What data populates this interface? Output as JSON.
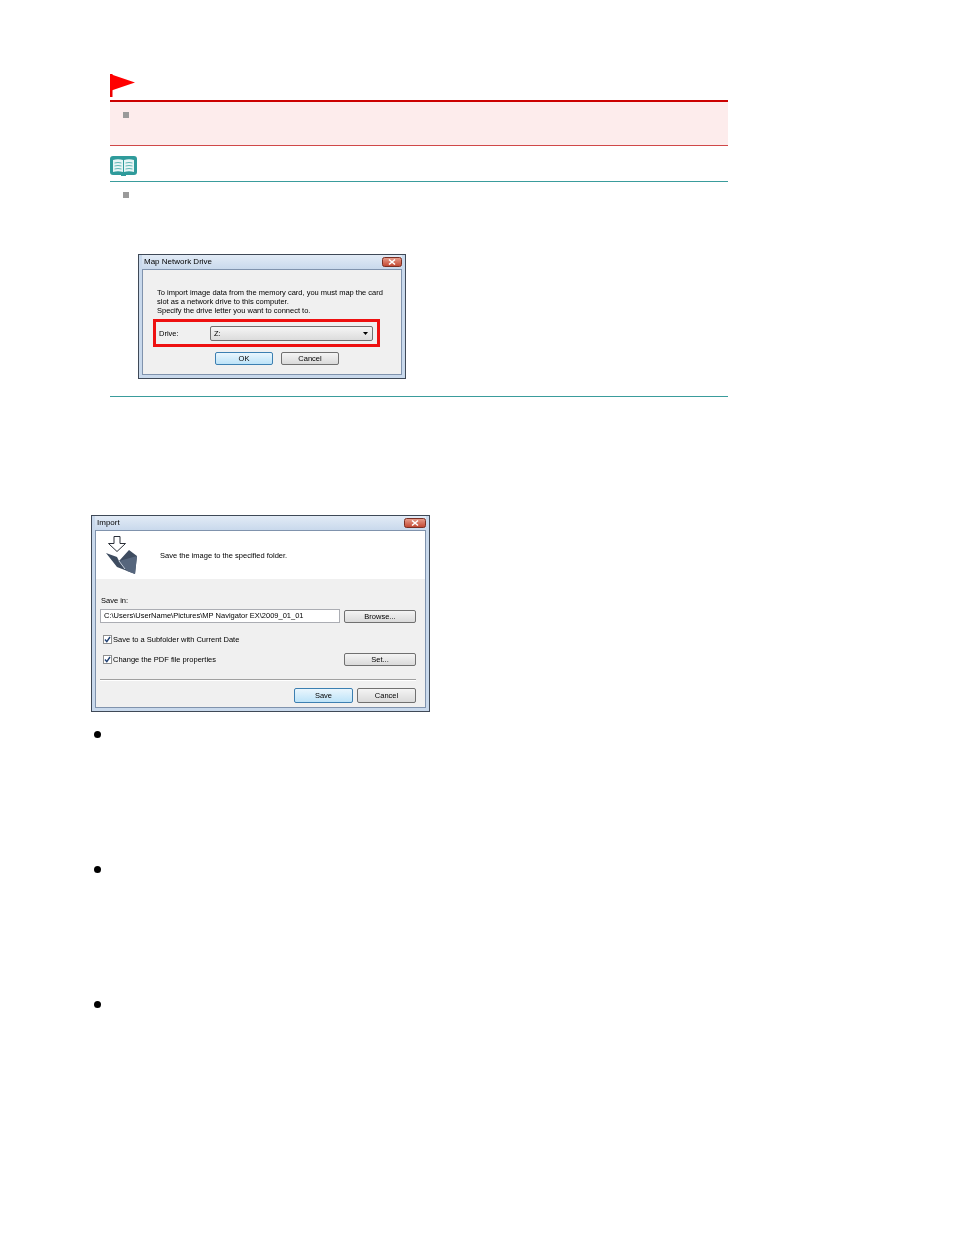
{
  "important_box": {
    "bullets": [
      {
        "kind": "square"
      }
    ]
  },
  "note_box": {
    "bullets": [
      {
        "kind": "square"
      }
    ],
    "dialog": {
      "title": "Map Network Drive",
      "message": [
        "To import image data from the memory card, you must map the card slot as a network drive to this computer.",
        "Specify the drive letter you want to connect to."
      ],
      "drive_label": "Drive:",
      "drive_value": "Z:",
      "highlighted": true,
      "buttons": [
        {
          "label": "OK",
          "default": true
        },
        {
          "label": "Cancel",
          "default": false
        }
      ]
    }
  },
  "import_dialog": {
    "title": "Import",
    "header": "Save the image to the specified folder.",
    "save_in_label": "Save in:",
    "save_in_value": "C:\\Users\\UserName\\Pictures\\MP Navigator EX\\2009_01_01",
    "browse_button": "Browse...",
    "options": [
      {
        "label": "Save to a Subfolder with Current Date",
        "checked": true
      },
      {
        "label": "Change the PDF file properties",
        "checked": true,
        "button": "Set..."
      }
    ],
    "buttons": [
      {
        "label": "Save",
        "default": true
      },
      {
        "label": "Cancel",
        "default": false
      }
    ]
  },
  "bullets": [
    {
      "kind": "disc"
    },
    {
      "kind": "disc"
    },
    {
      "kind": "disc"
    }
  ]
}
